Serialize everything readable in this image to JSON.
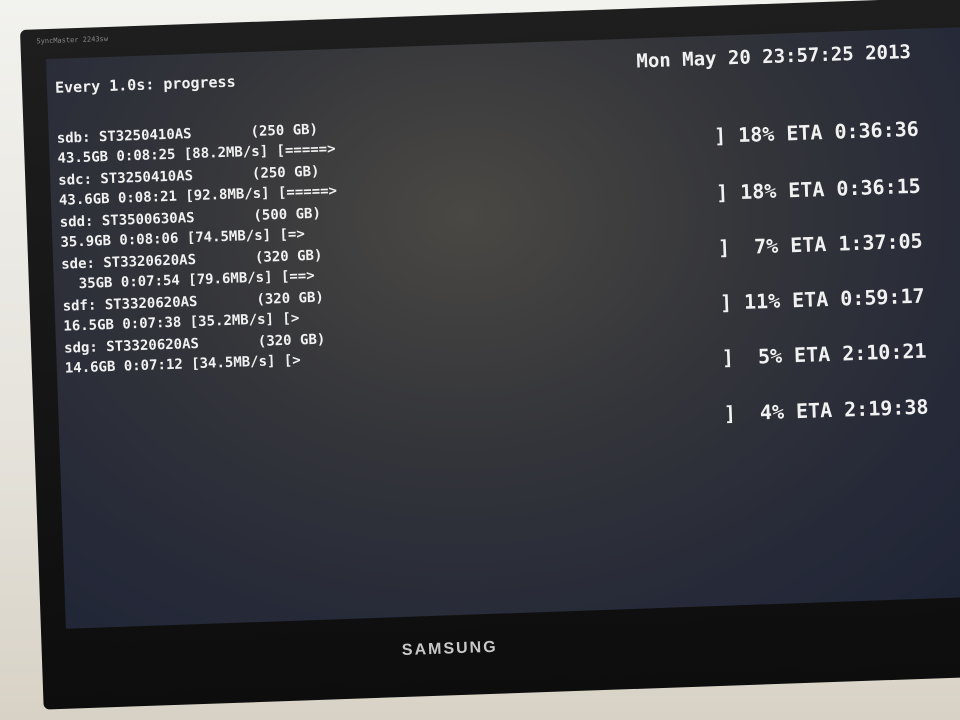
{
  "monitor": {
    "model": "SyncMaster 2243sw",
    "brand": "SAMSUNG"
  },
  "terminal": {
    "header": "Every 1.0s: progress",
    "clock": "Mon May 20 23:57:25 2013",
    "drives": [
      {
        "title": "sdb: ST3250410AS       (250 GB)",
        "progress": "43.5GB 0:08:25 [88.2MB/s] [=====>",
        "status": "] 18% ETA 0:36:36",
        "percent": 18
      },
      {
        "title": "sdc: ST3250410AS       (250 GB)",
        "progress": "43.6GB 0:08:21 [92.8MB/s] [=====>",
        "status": "] 18% ETA 0:36:15",
        "percent": 18
      },
      {
        "title": "sdd: ST3500630AS       (500 GB)",
        "progress": "35.9GB 0:08:06 [74.5MB/s] [=>",
        "status": "]  7% ETA 1:37:05",
        "percent": 7
      },
      {
        "title": "sde: ST3320620AS       (320 GB)",
        "progress": "  35GB 0:07:54 [79.6MB/s] [==>",
        "status": "] 11% ETA 0:59:17",
        "percent": 11
      },
      {
        "title": "sdf: ST3320620AS       (320 GB)",
        "progress": "16.5GB 0:07:38 [35.2MB/s] [>",
        "status": "]  5% ETA 2:10:21",
        "percent": 5
      },
      {
        "title": "sdg: ST3320620AS       (320 GB)",
        "progress": "14.6GB 0:07:12 [34.5MB/s] [>",
        "status": "]  4% ETA 2:19:38",
        "percent": 4
      }
    ]
  }
}
